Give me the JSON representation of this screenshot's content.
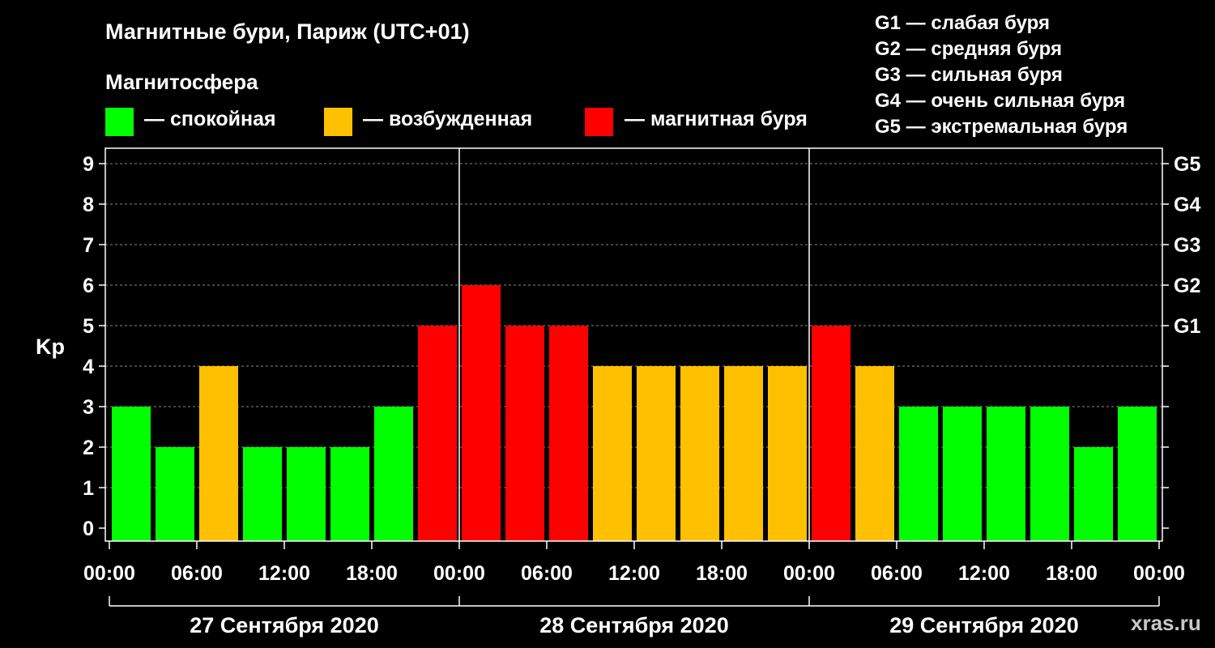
{
  "header": {
    "title": "Магнитные бури, Париж (UTC+01)",
    "subtitle": "Магнитосфера"
  },
  "legend": [
    {
      "label": "— спокойная",
      "color": "#00ff00"
    },
    {
      "label": "— возбужденная",
      "color": "#ffc000"
    },
    {
      "label": "— магнитная буря",
      "color": "#ff0000"
    }
  ],
  "storm_levels": [
    "G1 — слабая буря",
    "G2 — средняя буря",
    "G3 — сильная буря",
    "G4 — очень сильная буря",
    "G5 — экстремальная буря"
  ],
  "watermark": "xras.ru",
  "chart_data": {
    "type": "bar",
    "ylabel": "Kp",
    "ylim": [
      0,
      9
    ],
    "yticks": [
      "0",
      "1",
      "2",
      "3",
      "4",
      "5",
      "6",
      "7",
      "8",
      "9"
    ],
    "right_ticks": [
      {
        "value": 5,
        "label": "G1"
      },
      {
        "value": 6,
        "label": "G2"
      },
      {
        "value": 7,
        "label": "G3"
      },
      {
        "value": 8,
        "label": "G4"
      },
      {
        "value": 9,
        "label": "G5"
      }
    ],
    "xticks": [
      "00:00",
      "06:00",
      "12:00",
      "18:00",
      "00:00",
      "06:00",
      "12:00",
      "18:00",
      "00:00",
      "06:00",
      "12:00",
      "18:00",
      "00:00"
    ],
    "days": [
      "27 Сентября 2020",
      "28 Сентября 2020",
      "29 Сентября 2020"
    ],
    "bar_hours": [
      1.5,
      4.5,
      7.5,
      10.5,
      13.5,
      16.5,
      19.5,
      22.5,
      1.5,
      4.5,
      7.5,
      10.5,
      13.5,
      16.5,
      19.5,
      22.5,
      1.5,
      4.5,
      7.5,
      10.5,
      13.5,
      16.5,
      19.5,
      22.5
    ],
    "values": [
      3,
      2,
      4,
      2,
      2,
      2,
      3,
      5,
      6,
      5,
      5,
      4,
      4,
      4,
      4,
      4,
      5,
      4,
      3,
      3,
      3,
      3,
      2,
      3
    ],
    "colors": {
      "quiet": "#00ff00",
      "active": "#ffc000",
      "storm": "#ff0000"
    },
    "grid": true
  }
}
